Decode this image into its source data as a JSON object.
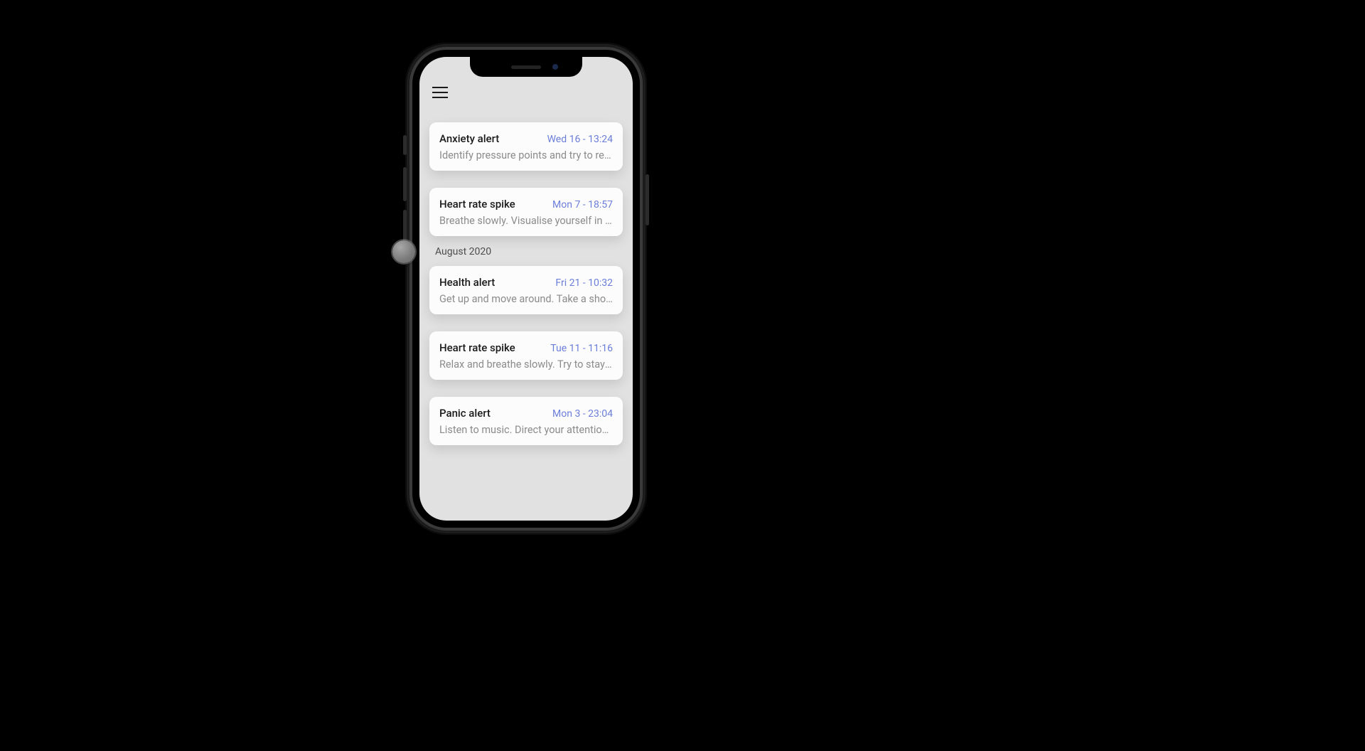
{
  "sections": [
    {
      "label": null,
      "items": [
        {
          "title": "Anxiety alert",
          "time": "Wed 16 - 13:24",
          "body": "Identify pressure points and try to reduce stress."
        },
        {
          "title": "Heart rate spike",
          "time": "Mon 7 - 18:57",
          "body": "Breathe slowly. Visualise yourself in a calm place."
        }
      ]
    },
    {
      "label": "August 2020",
      "items": [
        {
          "title": "Health alert",
          "time": "Fri 21 - 10:32",
          "body": "Get up and move around. Take a short walk."
        },
        {
          "title": "Heart rate spike",
          "time": "Tue 11 - 11:16",
          "body": "Relax and breathe slowly. Try to stay calm."
        },
        {
          "title": "Panic alert",
          "time": "Mon 3 - 23:04",
          "body": "Listen to music. Direct your attention elsewhere."
        }
      ]
    }
  ]
}
